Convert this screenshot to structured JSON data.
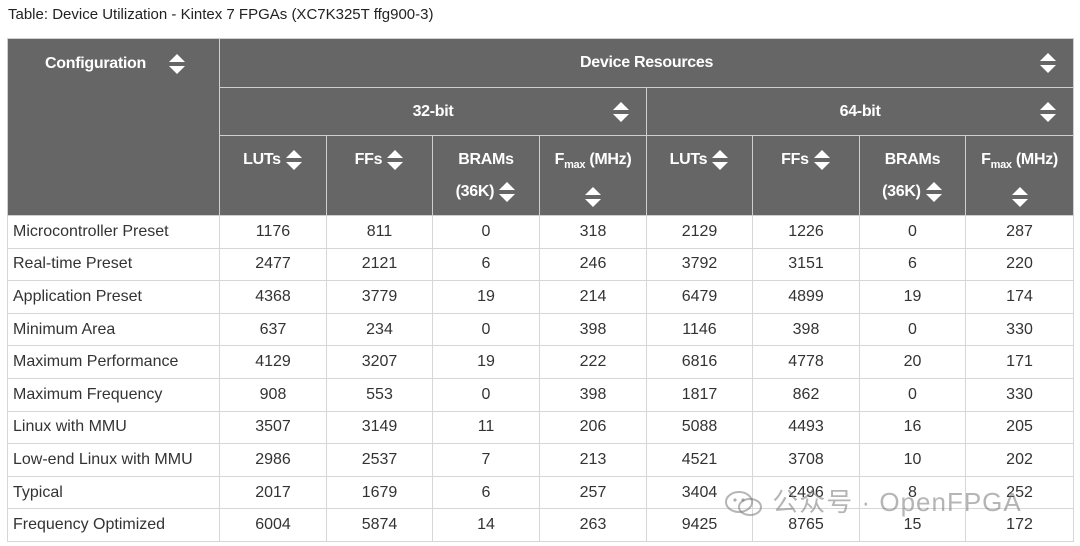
{
  "caption": "Table: Device Utilization - Kintex 7 FPGAs (XC7K325T ffg900-3)",
  "header": {
    "configuration": "Configuration",
    "device_resources": "Device Resources",
    "group32": "32-bit",
    "group64": "64-bit",
    "luts": "LUTs",
    "ffs": "FFs",
    "brams": "BRAMs",
    "brams_unit": "(36K)",
    "fmax_f": "F",
    "fmax_sub": "max",
    "fmax_unit": "(MHz)"
  },
  "rows": [
    {
      "config": "Microcontroller Preset",
      "v": [
        "1176",
        "811",
        "0",
        "318",
        "2129",
        "1226",
        "0",
        "287"
      ]
    },
    {
      "config": "Real-time Preset",
      "v": [
        "2477",
        "2121",
        "6",
        "246",
        "3792",
        "3151",
        "6",
        "220"
      ]
    },
    {
      "config": "Application Preset",
      "v": [
        "4368",
        "3779",
        "19",
        "214",
        "6479",
        "4899",
        "19",
        "174"
      ]
    },
    {
      "config": "Minimum Area",
      "v": [
        "637",
        "234",
        "0",
        "398",
        "1146",
        "398",
        "0",
        "330"
      ]
    },
    {
      "config": "Maximum Performance",
      "v": [
        "4129",
        "3207",
        "19",
        "222",
        "6816",
        "4778",
        "20",
        "171"
      ]
    },
    {
      "config": "Maximum Frequency",
      "v": [
        "908",
        "553",
        "0",
        "398",
        "1817",
        "862",
        "0",
        "330"
      ]
    },
    {
      "config": "Linux with MMU",
      "v": [
        "3507",
        "3149",
        "11",
        "206",
        "5088",
        "4493",
        "16",
        "205"
      ]
    },
    {
      "config": "Low-end Linux with MMU",
      "v": [
        "2986",
        "2537",
        "7",
        "213",
        "4521",
        "3708",
        "10",
        "202"
      ]
    },
    {
      "config": "Typical",
      "v": [
        "2017",
        "1679",
        "6",
        "257",
        "3404",
        "2496",
        "8",
        "252"
      ]
    },
    {
      "config": "Frequency Optimized",
      "v": [
        "6004",
        "5874",
        "14",
        "263",
        "9425",
        "8765",
        "15",
        "172"
      ]
    }
  ],
  "watermark": "公众号 · OpenFPGA",
  "icons": {
    "sort": "sort-icon",
    "watermark": "wechat-icon"
  },
  "colors": {
    "header_bg": "#666666",
    "header_text": "#ffffff",
    "border": "#d6d6d6",
    "text": "#333333"
  }
}
